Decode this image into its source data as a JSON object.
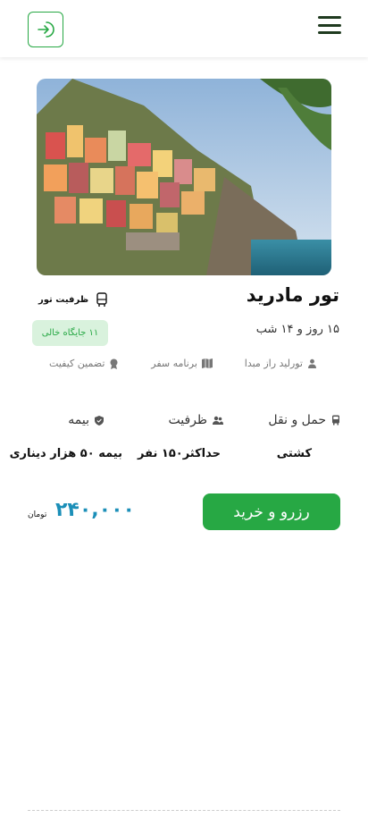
{
  "header": {
    "login_icon": "login-arrow-icon",
    "menu_icon": "hamburger-menu-icon"
  },
  "tour": {
    "title": "تور مادرید",
    "duration": "۱۵ روز و ۱۴ شب",
    "capacity_label": "ظرفیت تور",
    "capacity_badge": "۱۱ جایگاه خالی",
    "features": [
      {
        "label": "تورلید راز مبدا",
        "icon": "person-icon"
      },
      {
        "label": "برنامه سفر",
        "icon": "map-icon"
      },
      {
        "label": "تضمین کیفیت",
        "icon": "quality-badge-icon"
      }
    ],
    "specs": {
      "transport": {
        "title": "حمل و نقل",
        "value": "کشتی",
        "icon": "bus-icon"
      },
      "capacity": {
        "title": "ظرفیت",
        "value": "حداکثر۱۵۰ نفر",
        "icon": "users-icon"
      },
      "insurance": {
        "title": "بیمه",
        "value": "بیمه ۵۰ هزار دیناری",
        "icon": "shield-icon"
      }
    }
  },
  "purchase": {
    "button_label": "رزرو و خرید",
    "price": "۲۴۰,۰۰۰",
    "currency": "تومان"
  },
  "colors": {
    "accent": "#27a844",
    "price": "#1c8fb8"
  }
}
